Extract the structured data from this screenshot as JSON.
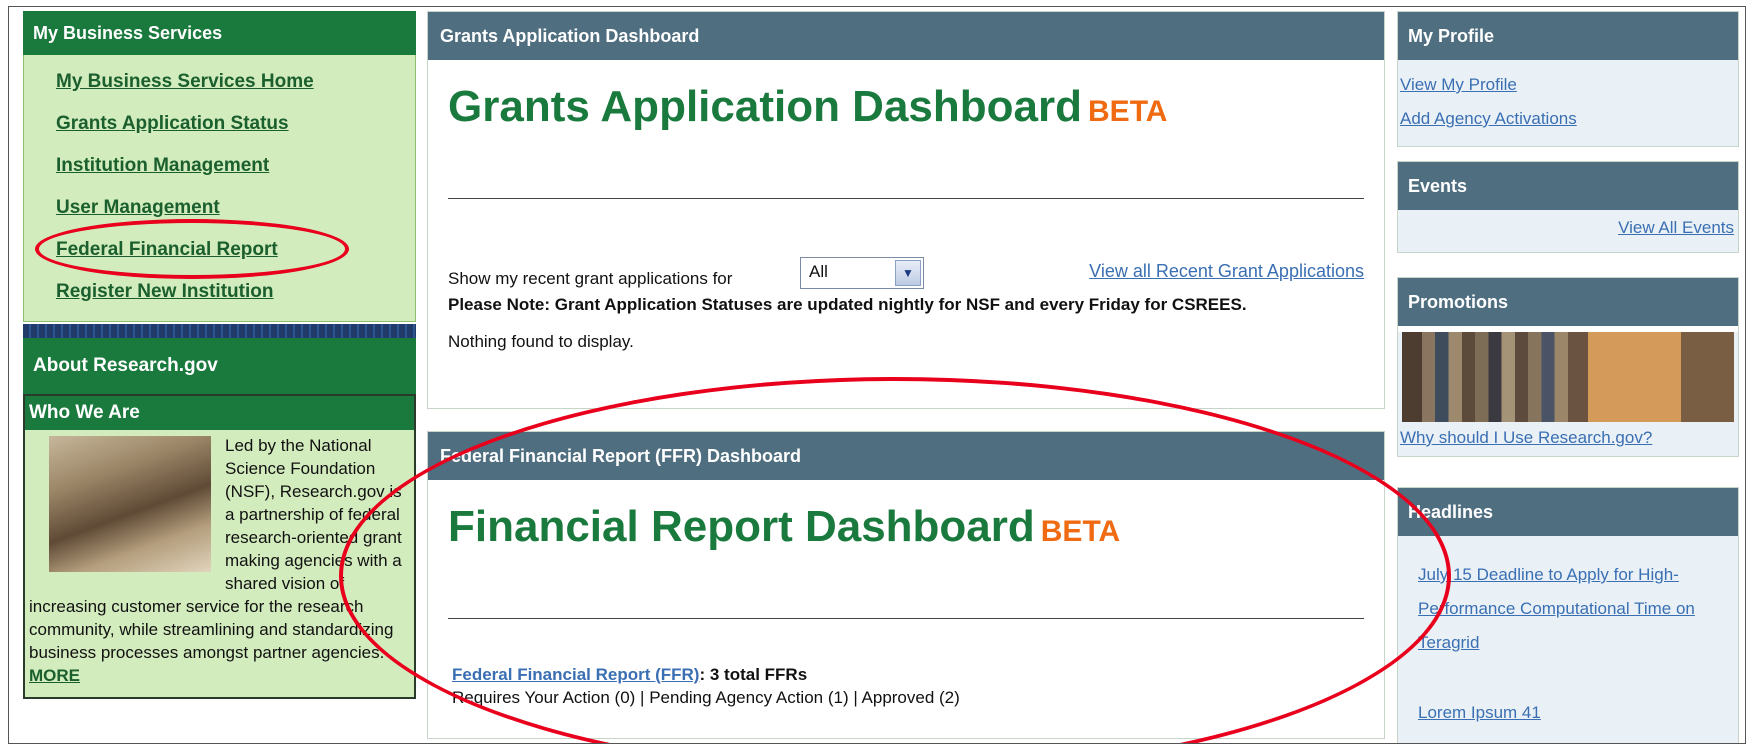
{
  "left": {
    "header": "My Business Services",
    "menu": [
      "My Business Services Home",
      "Grants Application Status",
      "Institution Management",
      "User Management",
      "Federal Financial Report",
      "Register New Institution"
    ],
    "about_header": "About Research.gov",
    "who_header": "Who We Are",
    "who_text": "Led by the National Science Foundation (NSF), Research.gov is a partnership of federal research-oriented grant making agencies with a shared vision of increasing customer service for the research community, while streamlining and standardizing business processes amongst partner agencies.",
    "more_link": "MORE"
  },
  "grants": {
    "header": "Grants Application Dashboard",
    "title": "Grants Application Dashboard",
    "beta": "BETA",
    "show_label": "Show my recent grant applications for",
    "select_value": "All",
    "view_all_link": "View all Recent Grant Applications",
    "note": "Please Note: Grant Application Statuses are updated nightly for NSF and every Friday for CSREES.",
    "nothing": "Nothing found to display."
  },
  "ffr": {
    "header": "Federal Financial Report (FFR) Dashboard",
    "title": "Financial Report Dashboard",
    "beta": "BETA",
    "link": "Federal Financial Report (FFR)",
    "total": ": 3 total FFRs",
    "status": "Requires Your Action (0) | Pending Agency Action (1) | Approved (2)"
  },
  "right": {
    "profile_header": "My Profile",
    "profile_links": [
      "View My Profile",
      "Add Agency Activations"
    ],
    "events_header": "Events",
    "events_link": "View All Events",
    "promotions_header": "Promotions",
    "promotions_link": "Why should I Use Research.gov?",
    "headlines_header": "Headlines",
    "headline_1": "July 15 Deadline to Apply for High-Performance Computational Time on Teragrid",
    "headline_2": "Lorem Ipsum 41"
  },
  "annotation_color": "#e8001c"
}
